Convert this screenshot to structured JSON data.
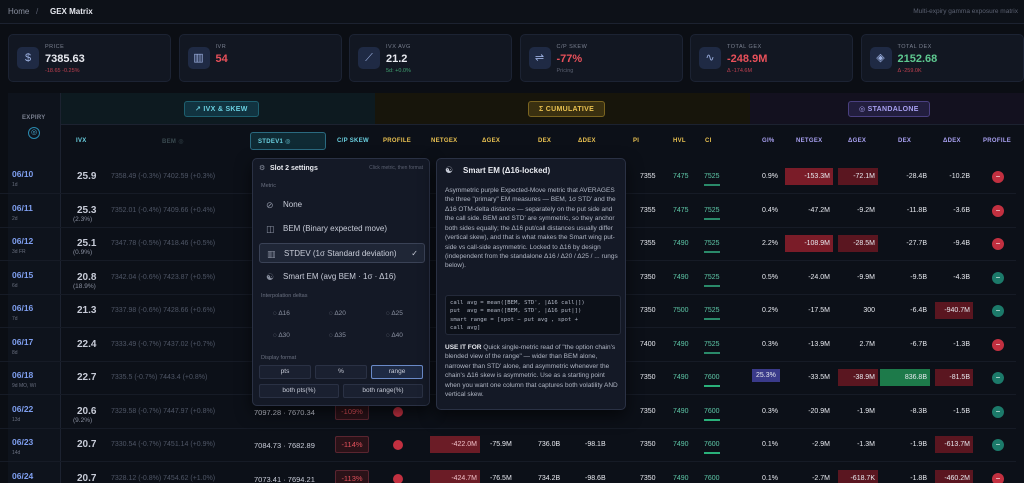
{
  "topbar": {
    "home": "Home",
    "sep": "/",
    "page": "GEX Matrix",
    "tagline": "Multi-expiry gamma exposure matrix"
  },
  "cards": [
    {
      "icon": "$",
      "label": "PRICE",
      "value": "7385.63",
      "sub": "-18.65 -0.25%",
      "color": "#e8eaf0",
      "subcolor": "#c04050"
    },
    {
      "icon": "▥",
      "label": "IVR",
      "value": "54",
      "sub": "",
      "color": "#e8505a",
      "subcolor": "#5a6070"
    },
    {
      "icon": "⟋",
      "label": "IVX AVG",
      "value": "21.2",
      "sub": "5d: +0.0%",
      "color": "#e8eaf0",
      "subcolor": "#40a070"
    },
    {
      "icon": "⇌",
      "label": "C/P SKEW",
      "value": "-77%",
      "sub": "Pricing",
      "color": "#e8505a",
      "subcolor": "#5a6070"
    },
    {
      "icon": "∿",
      "label": "TOTAL GEX",
      "value": "-248.9M",
      "sub": "Δ -174.6M",
      "color": "#e8505a",
      "subcolor": "#c04050"
    },
    {
      "icon": "◈",
      "label": "TOTAL DEX",
      "value": "2152.68",
      "sub": "Δ -259.0K",
      "color": "#5ec890",
      "subcolor": "#c04050"
    }
  ],
  "groups": {
    "ivx": "↗ IVX & SKEW",
    "cum": "Σ CUMULATIVE",
    "std": "◎ STANDALONE"
  },
  "headers": {
    "expiry": "EXPIRY",
    "ivx": "IVX",
    "bem": "BEM ◎",
    "stdev": "STDEV1 ◎",
    "cps": "C/P SKEW",
    "profile": "PROFILE",
    "netgex": "NETGEX",
    "agex": "ΔGEX",
    "dex": "DEX",
    "adex": "ΔDEX",
    "pi": "PI",
    "hvl": "HVL",
    "ci": "CI",
    "gip": "GI%",
    "netgex2": "NETGEX",
    "agex2": "ΔGEX",
    "dex2": "DEX",
    "adex2": "ΔDEX",
    "profile2": "PROFILE"
  },
  "rows": [
    {
      "date": "06/10",
      "badge": "1d",
      "ivx": "25.9",
      "ivxs": "",
      "bem": "7358.49 (-0.3%)  7402.59 (+0.3%)",
      "stdev": "",
      "cps": "",
      "netgex": "",
      "agex": "",
      "dex": "",
      "adex": "",
      "pi": "7355",
      "hvl": "7475",
      "ci": "7525",
      "gip": "0.9%",
      "ng2": "-153.3M",
      "ag2": "-72.1M",
      "dx2": "-28.4B",
      "ad2": "-10.2B",
      "prof": "−",
      "profc": "#c23040"
    },
    {
      "date": "06/11",
      "badge": "2d",
      "ivx": "25.3",
      "ivxs": "(2.3%)",
      "bem": "7352.01 (-0.4%)  7409.66 (+0.4%)",
      "stdev": "",
      "cps": "",
      "netgex": "",
      "agex": "",
      "dex": "",
      "adex": "",
      "pi": "7355",
      "hvl": "7475",
      "ci": "7525",
      "gip": "0.4%",
      "ng2": "-47.2M",
      "ag2": "-9.2M",
      "dx2": "-11.8B",
      "ad2": "-3.6B",
      "prof": "−",
      "profc": "#c23040"
    },
    {
      "date": "06/12",
      "badge": "3d  FR",
      "ivx": "25.1",
      "ivxs": "(0.9%)",
      "bem": "7347.78 (-0.5%)  7418.46 (+0.5%)",
      "stdev": "",
      "cps": "",
      "netgex": "",
      "agex": "",
      "dex": "",
      "adex": "",
      "pi": "7355",
      "hvl": "7490",
      "ci": "7525",
      "gip": "2.2%",
      "ng2": "-108.9M",
      "ag2": "-28.5M",
      "dx2": "-27.7B",
      "ad2": "-9.4B",
      "prof": "−",
      "profc": "#c23040"
    },
    {
      "date": "06/15",
      "badge": "6d",
      "ivx": "20.8",
      "ivxs": "(18.9%)",
      "bem": "7342.04 (-0.6%)  7423.87 (+0.5%)",
      "stdev": "",
      "cps": "",
      "netgex": "",
      "agex": "",
      "dex": "",
      "adex": "",
      "pi": "7350",
      "hvl": "7490",
      "ci": "7525",
      "gip": "0.5%",
      "ng2": "-24.0M",
      "ag2": "-9.9M",
      "dx2": "-9.5B",
      "ad2": "-4.3B",
      "prof": "−",
      "profc": "#1c7a6a"
    },
    {
      "date": "06/16",
      "badge": "7d",
      "ivx": "21.3",
      "ivxs": "",
      "bem": "7337.98 (-0.6%)  7428.66 (+0.6%)",
      "stdev": "",
      "cps": "",
      "netgex": "",
      "agex": "",
      "dex": "",
      "adex": "",
      "pi": "7350",
      "hvl": "7500",
      "ci": "7525",
      "gip": "0.2%",
      "ng2": "-17.5M",
      "ag2": "300",
      "dx2": "-6.4B",
      "ad2": "-940.7M",
      "prof": "−",
      "profc": "#1c7a6a"
    },
    {
      "date": "06/17",
      "badge": "8d",
      "ivx": "22.4",
      "ivxs": "",
      "bem": "7333.49 (-0.7%)  7437.02 (+0.7%)",
      "stdev": "",
      "cps": "",
      "netgex": "",
      "agex": "",
      "dex": "",
      "adex": "",
      "pi": "7400",
      "hvl": "7490",
      "ci": "7525",
      "gip": "0.3%",
      "ng2": "-13.9M",
      "ag2": "2.7M",
      "dx2": "-6.7B",
      "ad2": "-1.3B",
      "prof": "−",
      "profc": "#c23040"
    },
    {
      "date": "06/18",
      "badge": "9d  MO, WI",
      "ivx": "22.7",
      "ivxs": "",
      "bem": "7335.5 (-0.7%)  7443.4 (+0.8%)",
      "stdev": "",
      "cps": "",
      "netgex": "",
      "agex": "",
      "dex": "",
      "adex": "",
      "pi": "7350",
      "hvl": "7490",
      "ci": "7600",
      "gip": "25.3%",
      "ng2": "-33.5M",
      "ag2": "-38.9M",
      "dx2": "836.8B",
      "ad2": "-81.5B",
      "prof": "−",
      "profc": "#1c7a6a"
    },
    {
      "date": "06/22",
      "badge": "13d",
      "ivx": "20.6",
      "ivxs": "(9.2%)",
      "bem": "7329.58 (-0.7%)  7447.97 (+0.8%)",
      "stdev": "7097.28 · 7670.34",
      "cps": "-109%",
      "netgex": "",
      "agex": "",
      "dex": "",
      "adex": "",
      "pi": "7350",
      "hvl": "7490",
      "ci": "7600",
      "gip": "0.3%",
      "ng2": "-20.9M",
      "ag2": "-1.9M",
      "dx2": "-8.3B",
      "ad2": "-1.5B",
      "prof": "−",
      "profc": "#1c7a6a"
    },
    {
      "date": "06/23",
      "badge": "14d",
      "ivx": "20.7",
      "ivxs": "",
      "bem": "7330.54 (-0.7%)  7451.14 (+0.9%)",
      "stdev": "7084.73 · 7682.89",
      "cps": "-114%",
      "netgex": "-422.0M",
      "agex": "-75.9M",
      "dex": "736.0B",
      "adex": "-98.1B",
      "pi": "7350",
      "hvl": "7490",
      "ci": "7600",
      "gip": "0.1%",
      "ng2": "-2.9M",
      "ag2": "-1.3M",
      "dx2": "-1.9B",
      "ad2": "-613.7M",
      "prof": "−",
      "profc": "#1c7a6a"
    },
    {
      "date": "06/24",
      "badge": "15d",
      "ivx": "20.7",
      "ivxs": "",
      "bem": "7328.12 (-0.8%)  7454.62 (+1.0%)",
      "stdev": "7073.41 · 7694.21",
      "cps": "-113%",
      "netgex": "-424.7M",
      "agex": "-76.5M",
      "dex": "734.2B",
      "adex": "-98.6B",
      "pi": "7350",
      "hvl": "7490",
      "ci": "7600",
      "gip": "0.1%",
      "ng2": "-2.7M",
      "ag2": "-618.7K",
      "dx2": "-1.8B",
      "ad2": "-460.2M",
      "prof": "−",
      "profc": "#c23040"
    }
  ],
  "slotmenu": {
    "title": "Slot 2 settings",
    "hint": "Click metric, then format",
    "metric_label": "Metric",
    "options": [
      {
        "icon": "⊘",
        "label": "None"
      },
      {
        "icon": "◫",
        "label": "BEM (Binary expected move)"
      },
      {
        "icon": "▥",
        "label": "STDEV (1σ Standard deviation)"
      },
      {
        "icon": "☯",
        "label": "Smart EM (avg BEM · 1σ · Δ16)"
      }
    ],
    "interp_label": "Interpolation deltas",
    "deltas": [
      "Δ16",
      "Δ20",
      "Δ25",
      "Δ30",
      "Δ35",
      "Δ40"
    ],
    "format_label": "Display format",
    "formats": [
      "pts",
      "%",
      "range",
      "both pts(%)",
      "both range(%)"
    ]
  },
  "info": {
    "title": "Smart EM (Δ16-locked)",
    "body": "Asymmetric purple Expected-Move metric that AVERAGES the three \"primary\" EM measures — BEM, 1σ STD' and the Δ16 OTM-delta distance — separately on the put side and the call side. BEM and STD' are symmetric, so they anchor both sides equally; the Δ16 put/call distances usually differ (vertical skew), and that is what makes the Smart wing put-side vs call-side asymmetric. Locked to Δ16 by design (independent from the standalone Δ16 / Δ20 / Δ25 / ... rungs below).",
    "code": "call avg = mean([BEM, STD', |Δ16 call|])\nput  avg = mean([BEM, STD', |Δ16 put|])\nsmart range = [spot − put avg , spot +\ncall avg]",
    "use_label": "USE IT FOR",
    "use_text": "Quick single-metric read of \"the option chain's blended view of the range\" — wider than BEM alone, narrower than STD' alone, and asymmetric whenever the chain's Δ16 skew is asymmetric. Use as a starting point when you want one column that captures both volatility AND vertical skew."
  }
}
